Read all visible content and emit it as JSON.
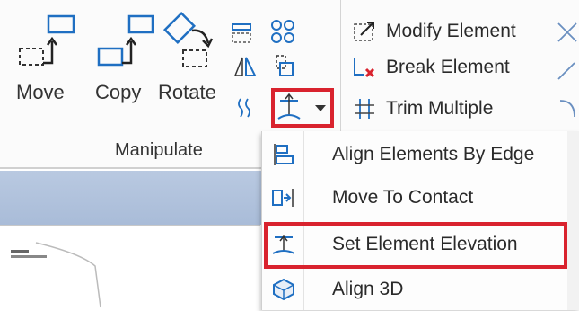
{
  "ribbon": {
    "group_label": "Manipulate",
    "big_buttons": [
      {
        "label": "Move"
      },
      {
        "label": "Copy"
      },
      {
        "label": "Rotate"
      }
    ],
    "right_commands": [
      {
        "label": "Modify Element",
        "icon": "modify-element-icon"
      },
      {
        "label": "Break Element",
        "icon": "break-element-icon"
      },
      {
        "label": "Trim Multiple",
        "icon": "trim-multiple-icon"
      }
    ]
  },
  "dropdown_menu": {
    "items": [
      {
        "label": "Align Elements By Edge",
        "icon": "align-by-edge-icon"
      },
      {
        "label": "Move To Contact",
        "icon": "move-to-contact-icon"
      },
      {
        "label": "Set Element Elevation",
        "icon": "set-elevation-icon",
        "highlighted": true
      },
      {
        "label": "Align 3D",
        "icon": "align-3d-icon"
      }
    ]
  },
  "colors": {
    "accent_blue": "#1f6fc2",
    "highlight_red": "#d9232e",
    "view_bar": "#b0c2dc"
  }
}
